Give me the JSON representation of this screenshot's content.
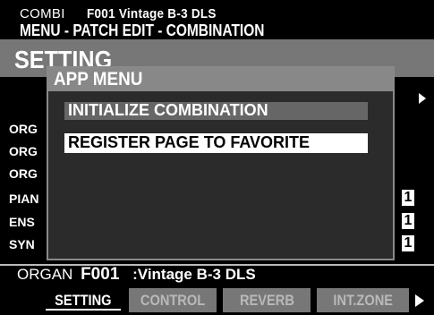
{
  "header": {
    "mode": "COMBI",
    "patch": "F001 Vintage B-3 DLS",
    "breadcrumb": "MENU - PATCH EDIT - COMBINATION"
  },
  "page": {
    "title": "SETTING"
  },
  "rows": [
    {
      "label": "ORG"
    },
    {
      "label": "ORG"
    },
    {
      "label": "ORG"
    },
    {
      "label": "PIAN",
      "value": "1"
    },
    {
      "label": "ENS",
      "value": "1"
    },
    {
      "label": "SYN",
      "value": "1"
    }
  ],
  "popup": {
    "title": "APP MENU",
    "items": [
      {
        "label": "INITIALIZE COMBINATION"
      },
      {
        "label": "REGISTER PAGE TO FAVORITE"
      }
    ]
  },
  "bottom": {
    "part": "ORGAN",
    "number": "F001",
    "name": ":Vintage B-3 DLS"
  },
  "tabs": [
    {
      "label": "SETTING"
    },
    {
      "label": "CONTROL"
    },
    {
      "label": "REVERB"
    },
    {
      "label": "INT.ZONE"
    }
  ],
  "icons": {
    "page_next": "arrow-right-icon",
    "tab_next": "arrow-right-icon"
  }
}
